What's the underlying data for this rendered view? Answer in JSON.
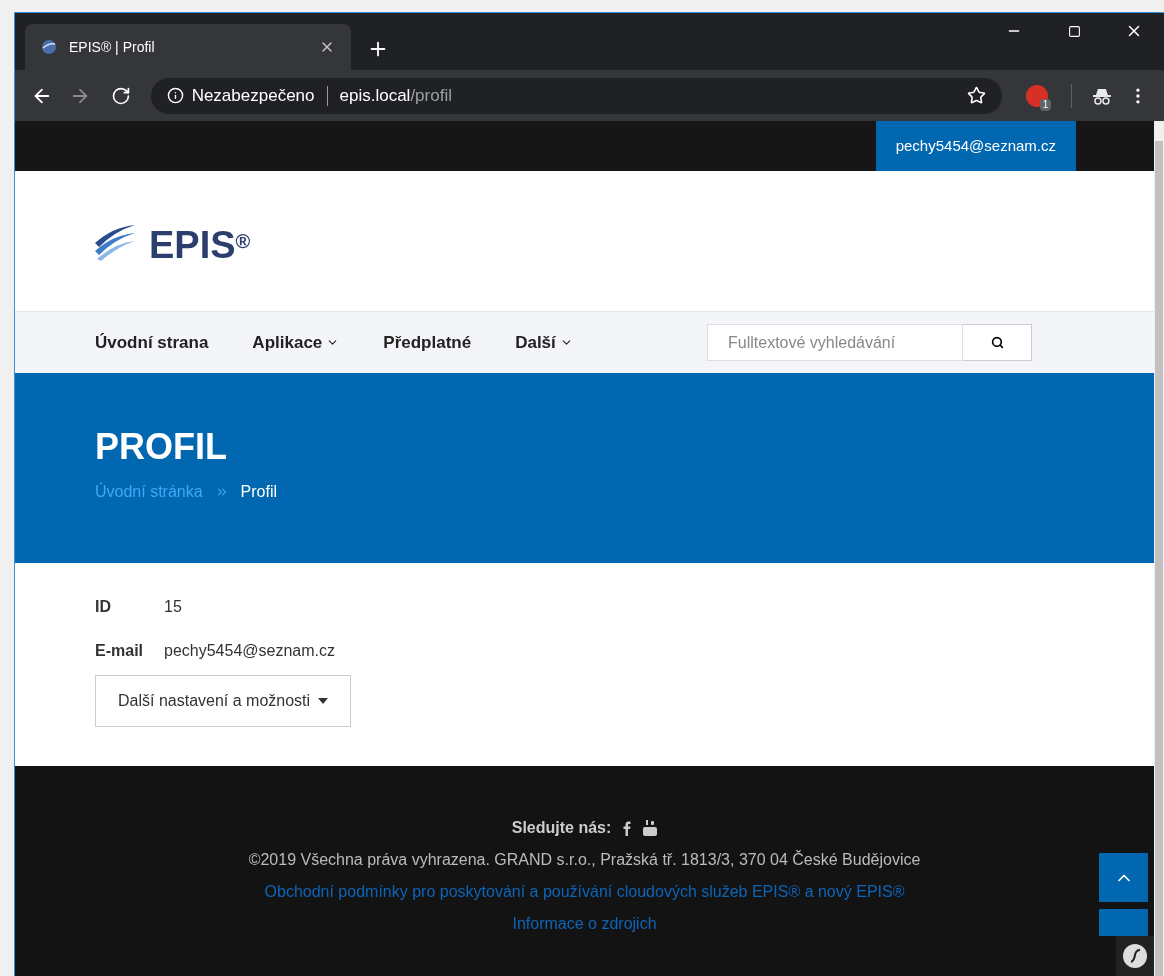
{
  "browser": {
    "tab_title": "EPIS® | Profil",
    "security_label": "Nezabezpečeno",
    "url_host": "epis.local",
    "url_path": "/profil",
    "extension_badge": "1"
  },
  "top_bar": {
    "user_email": "pechy5454@seznam.cz"
  },
  "logo": {
    "text": "EPIS",
    "mark": "®"
  },
  "nav": {
    "items": [
      {
        "label": "Úvodní strana",
        "dropdown": false
      },
      {
        "label": "Aplikace",
        "dropdown": true
      },
      {
        "label": "Předplatné",
        "dropdown": false
      },
      {
        "label": "Další",
        "dropdown": true
      }
    ],
    "search": {
      "placeholder": "Fulltextové vyhledávání"
    }
  },
  "hero": {
    "title": "PROFIL",
    "breadcrumb": [
      {
        "label": "Úvodní stránka",
        "link": true
      },
      {
        "label": "Profil",
        "link": false
      }
    ]
  },
  "profile": {
    "fields": [
      {
        "label": "ID",
        "value": "15"
      },
      {
        "label": "E-mail",
        "value": "pechy5454@seznam.cz"
      }
    ],
    "options_button": "Další nastavení a možnosti"
  },
  "footer": {
    "follow_label": "Sledujte nás:",
    "copyright": "©2019 Všechna práva vyhrazena. GRAND s.r.o., Pražská tř. 1813/3, 370 04 České Budějovice",
    "links": [
      "Obchodní podmínky pro poskytování a používání cloudových služeb EPIS® a nový EPIS®",
      "Informace o zdrojich"
    ]
  }
}
